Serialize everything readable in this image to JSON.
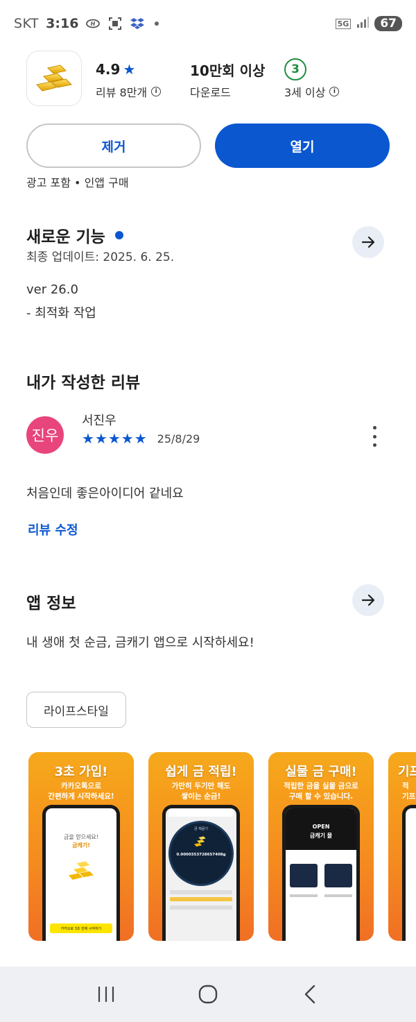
{
  "status_bar": {
    "carrier": "SKT",
    "time": "3:16",
    "network": "5G",
    "battery": "67"
  },
  "app": {
    "rating": "4.9",
    "rating_star": "★",
    "reviews": "리뷰 8만개",
    "downloads": "10만회 이상",
    "downloads_label": "다운로드",
    "age_badge": "3",
    "age_label": "3세 이상"
  },
  "actions": {
    "uninstall_label": "제거",
    "open_label": "열기",
    "ads_note": "광고 포함 • 인앱 구매"
  },
  "whats_new": {
    "title": "새로운 기능",
    "updated": "최종 업데이트: 2025. 6. 25.",
    "version": "ver 26.0",
    "notes": "- 최적화 작업"
  },
  "my_review": {
    "title": "내가 작성한 리뷰",
    "avatar_text": "진우",
    "reviewer": "서진우",
    "stars": "★★★★★",
    "date": "25/8/29",
    "text": "처음인데 좋은아이디어 같네요",
    "edit_label": "리뷰 수정"
  },
  "about": {
    "title": "앱 정보",
    "description": "내 생애 첫 순금, 금캐기 앱으로 시작하세요!",
    "category_chip": "라이프스타일"
  },
  "screenshots": [
    {
      "title": "3초 가입!",
      "subtitle": "카카오톡으로\n간편하게 시작하세요!",
      "screen_text": "금을 얻으세요!",
      "screen_accent": "금캐기!",
      "screen_button": "카카오로 3초 만에 시작하기"
    },
    {
      "title": "쉽게 금 적립!",
      "subtitle": "가만히 두기만 해도\n쌓이는 순금!",
      "counter": "0.0000353728657408g",
      "screen_label": "금 채굴기"
    },
    {
      "title": "실물 금 구매!",
      "subtitle": "적립한 금을 실물 금으로\n구매 할 수 있습니다.",
      "banner_open": "OPEN",
      "banner_name": "금캐기 몰"
    },
    {
      "title": "기프",
      "subtitle": "적\n기프"
    }
  ],
  "colors": {
    "accent": "#0b57d0",
    "avatar": "#e8457d",
    "age_green": "#1e8e3e",
    "shot_orange": "#f58a1f"
  }
}
